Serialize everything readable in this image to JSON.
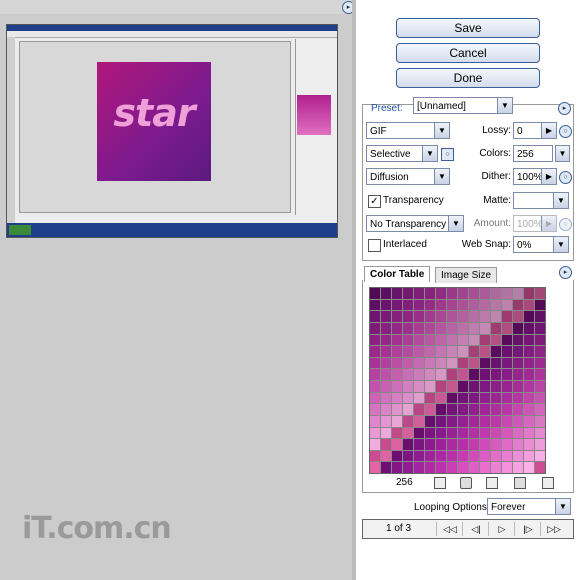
{
  "buttons": {
    "save": "Save",
    "cancel": "Cancel",
    "done": "Done"
  },
  "preset": {
    "label": "Preset:",
    "value": "[Unnamed]"
  },
  "format": {
    "value": "GIF"
  },
  "lossy": {
    "label": "Lossy:",
    "value": "0"
  },
  "reduction": {
    "value": "Selective"
  },
  "colors": {
    "label": "Colors:",
    "value": "256"
  },
  "dither_algo": {
    "value": "Diffusion"
  },
  "dither": {
    "label": "Dither:",
    "value": "100%"
  },
  "transparency": {
    "label": "Transparency",
    "checked": true
  },
  "matte": {
    "label": "Matte:"
  },
  "transparency_dither": {
    "value": "No Transparency ..."
  },
  "amount": {
    "label": "Amount:",
    "value": "100%"
  },
  "interlaced": {
    "label": "Interlaced",
    "checked": false
  },
  "websnap": {
    "label": "Web Snap:",
    "value": "0%"
  },
  "tabs": {
    "color_table": "Color Table",
    "image_size": "Image Size"
  },
  "color_count": "256",
  "looping": {
    "label": "Looping Options:",
    "value": "Forever"
  },
  "frames": {
    "counter": "1 of 3"
  },
  "preview_text": "star",
  "watermark": "iT.com.cn",
  "colors_palette": [
    "#6a0d6e",
    "#7b1480",
    "#8a1a8e",
    "#9a2196",
    "#a8289e",
    "#b52fa6",
    "#c23aae",
    "#ce4ab6",
    "#d65abd",
    "#de6ac4",
    "#e27acb",
    "#e88ad2",
    "#ec9ad8",
    "#f0aade",
    "#c54a8c",
    "#d9609e"
  ]
}
